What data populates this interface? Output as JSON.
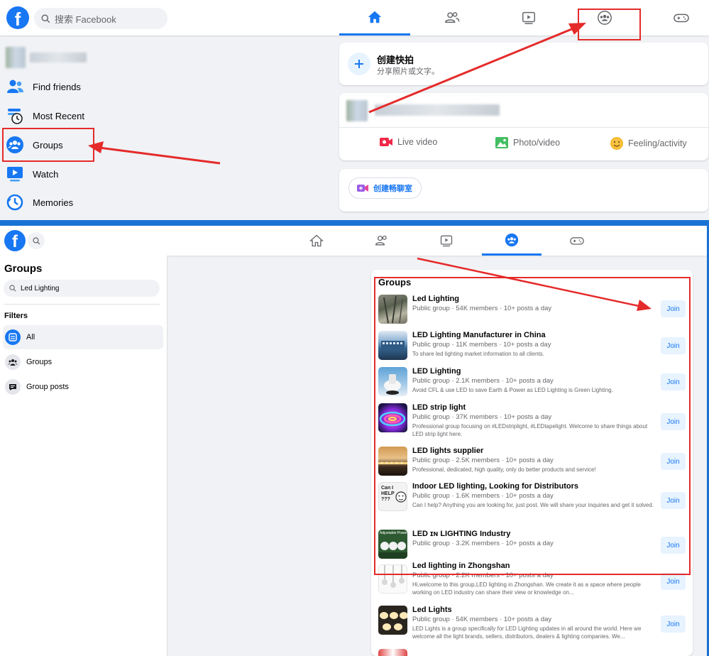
{
  "top": {
    "search_placeholder": "搜索 Facebook",
    "sidebar": [
      {
        "label": "Find friends",
        "icon": "friends-icon"
      },
      {
        "label": "Most Recent",
        "icon": "most-recent-icon"
      },
      {
        "label": "Groups",
        "icon": "groups-icon"
      },
      {
        "label": "Watch",
        "icon": "watch-icon"
      },
      {
        "label": "Memories",
        "icon": "memories-icon"
      }
    ],
    "create_post": {
      "title": "创建快拍",
      "subtitle": "分享照片或文字。"
    },
    "actions": {
      "live": "Live video",
      "photo": "Photo/video",
      "feeling": "Feeling/activity"
    },
    "room_button": "创建畅聊室"
  },
  "bottom": {
    "sidebar_title": "Groups",
    "search_value": "Led Lighting",
    "filters_heading": "Filters",
    "filters": [
      {
        "label": "All",
        "active": true
      },
      {
        "label": "Groups",
        "active": false
      },
      {
        "label": "Group posts",
        "active": false
      }
    ],
    "results_heading": "Groups",
    "join_label": "Join",
    "groups": [
      {
        "name": "Led Lighting",
        "meta": "Public group · 54K members · 10+ posts a day",
        "desc": ""
      },
      {
        "name": "LED Lighting Manufacturer in China",
        "meta": "Public group · 11K members · 10+ posts a day",
        "desc": "To share led lighting market information to all clients."
      },
      {
        "name": "LED Lighting",
        "meta": "Public group · 2.1K members · 10+ posts a day",
        "desc": "Avoid CFL & use LED to save Earth & Power as LED Lighting is Green Lighting."
      },
      {
        "name": "LED strip light",
        "meta": "Public group · 37K members · 10+ posts a day",
        "desc": "Professional group focusing on #LEDstriplight, #LEDtapelight. Welcome to share things about LED strip light here."
      },
      {
        "name": "LED lights supplier",
        "meta": "Public group · 2.5K members · 10+ posts a day",
        "desc": "Professional, dedicated, high quality, only do better products and service!"
      },
      {
        "name": "Indoor LED lighting, Looking for Distributors",
        "meta": "Public group · 1.6K members · 10+ posts a day",
        "desc": "Can I help? Anything you are looking for, just post. We will share your inquiries and get it solved."
      },
      {
        "name": "LED ɪɴ LIGHTING Industry",
        "meta": "Public group · 3.2K members · 10+ posts a day",
        "desc": ""
      },
      {
        "name": "Led lighting in Zhongshan",
        "meta": "Public group · 2.2K members · 10+ posts a day",
        "desc": "Hi,welcome to this group,LED lighting in Zhongshan. We create it as a space where people working on LED industry can share their view or knowledge on..."
      },
      {
        "name": "Led Lights",
        "meta": "Public group · 54K members · 10+ posts a day",
        "desc": "LED Lights is a group specifically for LED Lighting updates in all around the world. Here we welcome all the light brands, sellers, distributors, dealers & lighting companies. We..."
      }
    ],
    "thumb_text": {
      "indoor": "Can I HELP ???",
      "industry": "Adjustable Power"
    }
  },
  "colors": {
    "brand": "#1877f2",
    "annotation": "#e52a2a",
    "divider": "#1a72d4"
  }
}
